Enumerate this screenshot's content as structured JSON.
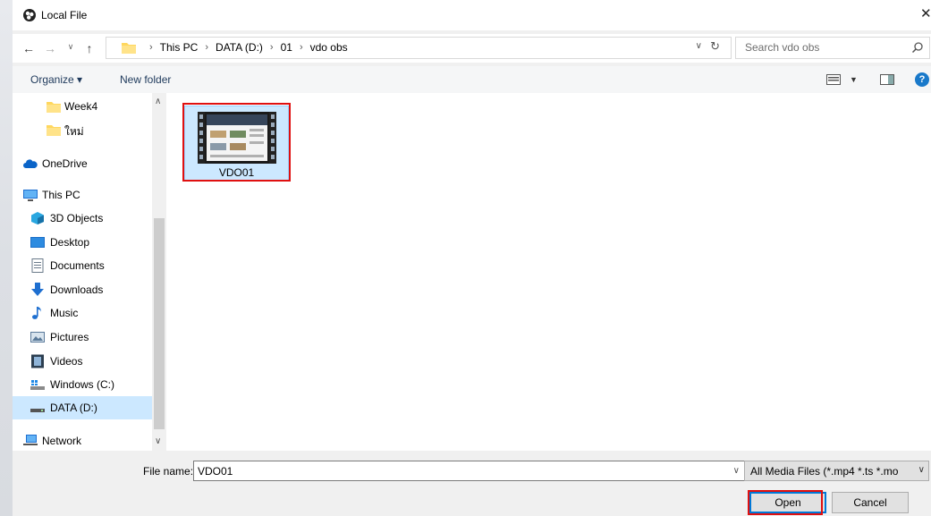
{
  "window": {
    "title": "Local File"
  },
  "nav": {
    "breadcrumbs": [
      "This PC",
      "DATA (D:)",
      "01",
      "vdo obs"
    ],
    "search_placeholder": "Search vdo obs"
  },
  "toolbar": {
    "organize_label": "Organize ▾",
    "new_folder_label": "New folder"
  },
  "sidebar": {
    "items": [
      {
        "label": "Week4",
        "icon": "folder-icon"
      },
      {
        "label": "ใหม่",
        "icon": "folder-icon"
      },
      {
        "label": "OneDrive",
        "icon": "cloud-icon"
      },
      {
        "label": "This PC",
        "icon": "pc-icon"
      },
      {
        "label": "3D Objects",
        "icon": "cube-icon"
      },
      {
        "label": "Desktop",
        "icon": "desktop-icon"
      },
      {
        "label": "Documents",
        "icon": "documents-icon"
      },
      {
        "label": "Downloads",
        "icon": "download-icon"
      },
      {
        "label": "Music",
        "icon": "music-icon"
      },
      {
        "label": "Pictures",
        "icon": "pictures-icon"
      },
      {
        "label": "Videos",
        "icon": "videos-icon"
      },
      {
        "label": "Windows (C:)",
        "icon": "drive-windows-icon"
      },
      {
        "label": "DATA (D:)",
        "icon": "drive-icon",
        "selected": true
      },
      {
        "label": "Network",
        "icon": "network-icon"
      }
    ]
  },
  "files": [
    {
      "name": "VDO01",
      "type": "video",
      "selected": true
    }
  ],
  "bottom": {
    "file_name_label": "File name:",
    "file_name_value": "VDO01",
    "file_type_value": "All Media Files (*.mp4 *.ts *.mo",
    "open_label": "Open",
    "cancel_label": "Cancel"
  },
  "colors": {
    "selection": "#cce8ff",
    "highlight_red": "#e01010",
    "accent_blue": "#0078d7"
  }
}
